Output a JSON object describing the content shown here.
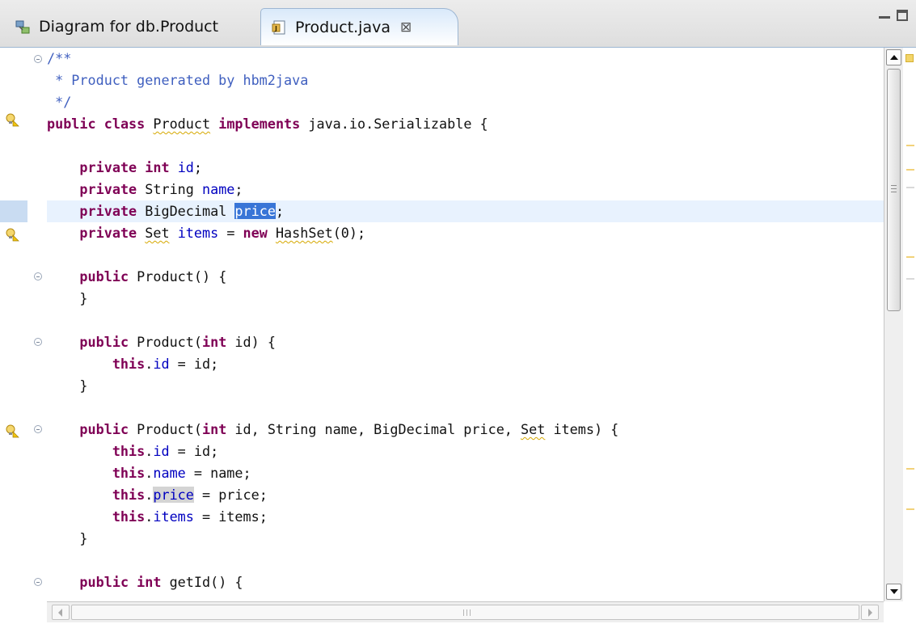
{
  "tabs": [
    {
      "label": "Diagram for db.Product",
      "icon": "diagram-icon",
      "active": false
    },
    {
      "label": "Product.java",
      "icon": "java-file-icon",
      "active": true,
      "close": "⊠"
    }
  ],
  "window_controls": {
    "minimize": "minimize-icon",
    "maximize": "maximize-icon"
  },
  "colors": {
    "keyword": "#7f0055",
    "field": "#0000c0",
    "javadoc": "#3f5fbf",
    "selection": "#3875d7",
    "current_line": "#e8f2fe"
  },
  "code": {
    "l1": {
      "text": "/**"
    },
    "l2": {
      "text": " * Product generated by hbm2java"
    },
    "l3": {
      "text": " */"
    },
    "l4": {
      "kw1": "public",
      "kw2": "class",
      "name": "Product",
      "kw3": "implements",
      "rest": "java.io.Serializable {"
    },
    "l6": {
      "kw": "private",
      "kw2": "int",
      "field": "id",
      "rest": ";"
    },
    "l7": {
      "kw": "private",
      "type": "String",
      "field": "name",
      "rest": ";"
    },
    "l8": {
      "kw": "private",
      "type": "BigDecimal",
      "field": "price",
      "rest": ";"
    },
    "l9": {
      "kw": "private",
      "type": "Set",
      "field": "items",
      "mid": " = ",
      "kw2": "new",
      "type2": "HashSet",
      "rest": "(0);"
    },
    "l11": {
      "kw": "public",
      "rest": "Product() {"
    },
    "l12": {
      "rest": "}"
    },
    "l14": {
      "kw": "public",
      "mid": "Product(",
      "kw2": "int",
      "rest": "id) {"
    },
    "l15": {
      "kw": "this",
      "dot": ".",
      "field": "id",
      "rest": " = id;"
    },
    "l16": {
      "rest": "}"
    },
    "l18": {
      "kw": "public",
      "mid": "Product(",
      "kw2": "int",
      "mid2": "id, String name, BigDecimal price, ",
      "type": "Set",
      "rest": "items) {"
    },
    "l19": {
      "kw": "this",
      "dot": ".",
      "field": "id",
      "rest": " = id;"
    },
    "l20": {
      "kw": "this",
      "dot": ".",
      "field": "name",
      "rest": " = name;"
    },
    "l21": {
      "kw": "this",
      "dot": ".",
      "field": "price",
      "rest": " = price;"
    },
    "l22": {
      "kw": "this",
      "dot": ".",
      "field": "items",
      "rest": " = items;"
    },
    "l23": {
      "rest": "}"
    },
    "l25": {
      "kw": "public",
      "kw2": "int",
      "rest": "getId() {"
    }
  }
}
